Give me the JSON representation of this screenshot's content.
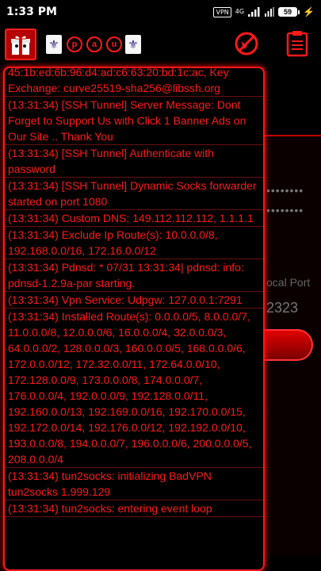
{
  "status_bar": {
    "time": "1:33 PM",
    "vpn_label": "VPN",
    "network": "4G",
    "battery": "59"
  },
  "background": {
    "local_port_label": "ocal Port",
    "local_port_value": "2323",
    "password_mask_1": "••••••••",
    "password_mask_2": "••••••••"
  },
  "toolbar": {
    "letters": [
      "p",
      "a",
      "u"
    ]
  },
  "log": {
    "entries": [
      "45:1b:ed:6b:96:d4:ad:c6:63:20:bd:1c:ac, Key Exchange: curve25519-sha256@libssh.org",
      "(13:31:34) [SSH Tunnel] Server Message: Dont Forget to Support Us with Click 1 Banner Ads on Our Site .. Thank You",
      "(13:31:34) [SSH Tunnel] Authenticate with password",
      "(13:31:34) [SSH Tunnel] Dynamic Socks forwarder started on port 1080",
      "(13:31:34) Custom DNS: 149.112.112.112, 1.1.1.1",
      "(13:31:34) Exclude Ip Route(s): 10.0.0.0/8, 192.168.0.0/16, 172.16.0.0/12",
      "(13:31:34) Pdnsd: * 07/31 13:31:34| pdnsd: info: pdnsd-1.2.9a-par starting.",
      "(13:31:34) Vpn Service: Udpgw: 127.0.0.1:7291",
      "(13:31:34) Installed Route(s): 0.0.0.0/5, 8.0.0.0/7, 11.0.0.0/8, 12.0.0.0/6, 16.0.0.0/4, 32.0.0.0/3, 64.0.0.0/2, 128.0.0.0/3, 160.0.0.0/5, 168.0.0.0/6, 172.0.0.0/12, 172.32.0.0/11, 172.64.0.0/10, 172.128.0.0/9, 173.0.0.0/8, 174.0.0.0/7, 176.0.0.0/4, 192.0.0.0/9, 192.128.0.0/11, 192.160.0.0/13, 192.169.0.0/16, 192.170.0.0/15, 192.172.0.0/14, 192.176.0.0/12, 192.192.0.0/10, 193.0.0.0/8, 194.0.0.0/7, 196.0.0.0/6, 200.0.0.0/5, 208.0.0.0/4",
      "(13:31:34) tun2socks: initializing BadVPN tun2socks 1.999.129",
      "(13:31:34) tun2socks: entering event loop"
    ]
  },
  "colors": {
    "accent": "#ff1a1a",
    "divider": "#6a1010",
    "background": "#000000"
  }
}
